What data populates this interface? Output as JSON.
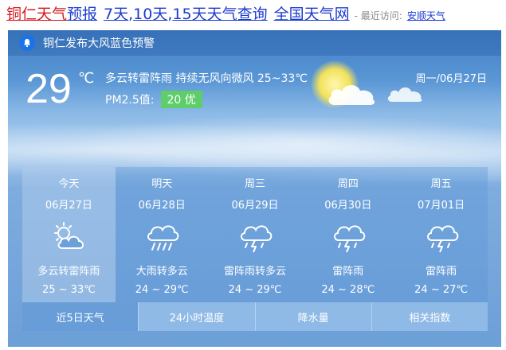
{
  "header": {
    "part_city": "铜仁天气",
    "part_forecast": "预报",
    "part_7": "7天",
    "sep1": ",",
    "part_10": "10天",
    "sep2": ",",
    "part_15": "15天天气查询",
    "part_national": "全国天气网",
    "recent_label": "- 最近访问:",
    "recent_link": "安顺天气"
  },
  "alert": {
    "text": "铜仁发布大风蓝色预警"
  },
  "current": {
    "temp": "29",
    "unit": "℃",
    "description": "多云转雷阵雨   持续无风向微风   25~33℃",
    "pm_label": "PM2.5值:",
    "pm_value": "20 优",
    "date": "周一/06月27日"
  },
  "forecast": [
    {
      "name": "今天",
      "date": "06月27日",
      "weather": "多云转雷阵雨",
      "range": "25 ~ 33℃",
      "icon": "partly-cloudy-icon"
    },
    {
      "name": "明天",
      "date": "06月28日",
      "weather": "大雨转多云",
      "range": "24 ~ 29℃",
      "icon": "heavy-rain-icon"
    },
    {
      "name": "周三",
      "date": "06月29日",
      "weather": "雷阵雨转多云",
      "range": "24 ~ 29℃",
      "icon": "thunderstorm-icon"
    },
    {
      "name": "周四",
      "date": "06月30日",
      "weather": "雷阵雨",
      "range": "24 ~ 28℃",
      "icon": "thunderstorm-icon"
    },
    {
      "name": "周五",
      "date": "07月01日",
      "weather": "雷阵雨",
      "range": "24 ~ 27℃",
      "icon": "thunderstorm-icon"
    }
  ],
  "tabs": [
    "近5日天气",
    "24小时温度",
    "降水量",
    "相关指数"
  ],
  "colors": {
    "link_red": "#d6171c",
    "link_blue": "#1c3bd0",
    "pm_good": "#5fce6a",
    "alert_bell": "#1a73e8"
  }
}
